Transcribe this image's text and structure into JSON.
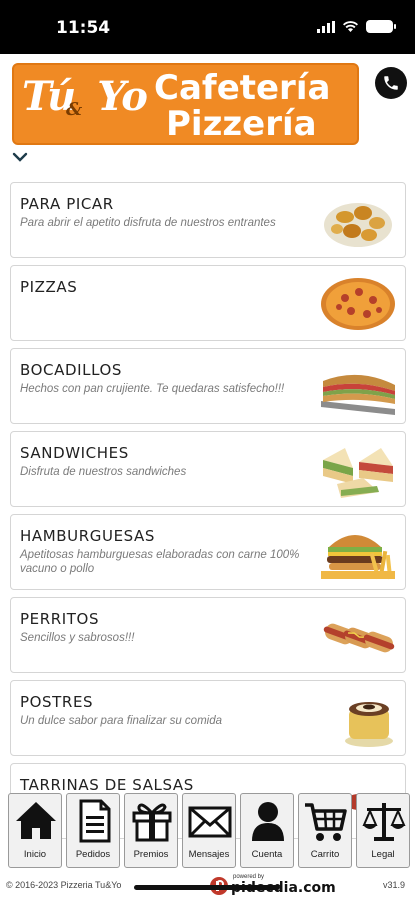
{
  "status": {
    "time": "11:54"
  },
  "header": {
    "logo_script": "Tú",
    "logo_amp": "&",
    "logo_script2": "Yo",
    "logo_line1": "Cafetería",
    "logo_line2": "Pizzería",
    "brand_color": "#f08a24"
  },
  "menu": {
    "items": [
      {
        "title": "PARA PICAR",
        "description": "Para abrir el apetito disfruta de nuestros entrantes",
        "image": "fried-snacks"
      },
      {
        "title": "PIZZAS",
        "description": "",
        "image": "pizza"
      },
      {
        "title": "BOCADILLOS",
        "description": "Hechos con pan crujiente. Te quedaras satisfecho!!!",
        "image": "baguette-sandwich"
      },
      {
        "title": "SANDWICHES",
        "description": "Disfruta de nuestros sandwiches",
        "image": "club-sandwich"
      },
      {
        "title": "HAMBURGUESAS",
        "description": "Apetitosas hamburguesas elaboradas con carne 100% vacuno o pollo",
        "image": "burger-fries"
      },
      {
        "title": "PERRITOS",
        "description": "Sencillos y sabrosos!!!",
        "image": "hot-dogs"
      },
      {
        "title": "POSTRES",
        "description": "Un dulce sabor para finalizar su comida",
        "image": "cake"
      },
      {
        "title": "TARRINAS DE SALSAS",
        "description": "",
        "image": "sauces"
      }
    ]
  },
  "tabs": [
    {
      "label": "Inicio",
      "icon": "home-icon"
    },
    {
      "label": "Pedidos",
      "icon": "document-icon"
    },
    {
      "label": "Premios",
      "icon": "gift-icon"
    },
    {
      "label": "Mensajes",
      "icon": "envelope-icon"
    },
    {
      "label": "Cuenta",
      "icon": "user-icon"
    },
    {
      "label": "Carrito",
      "icon": "cart-icon"
    },
    {
      "label": "Legal",
      "icon": "scales-icon"
    }
  ],
  "footer": {
    "copyright": "© 2016-2023  Pizzeria Tu&Yo",
    "powered_by": "powered by",
    "brand": "pidecdia.com",
    "version": "v31.9"
  }
}
